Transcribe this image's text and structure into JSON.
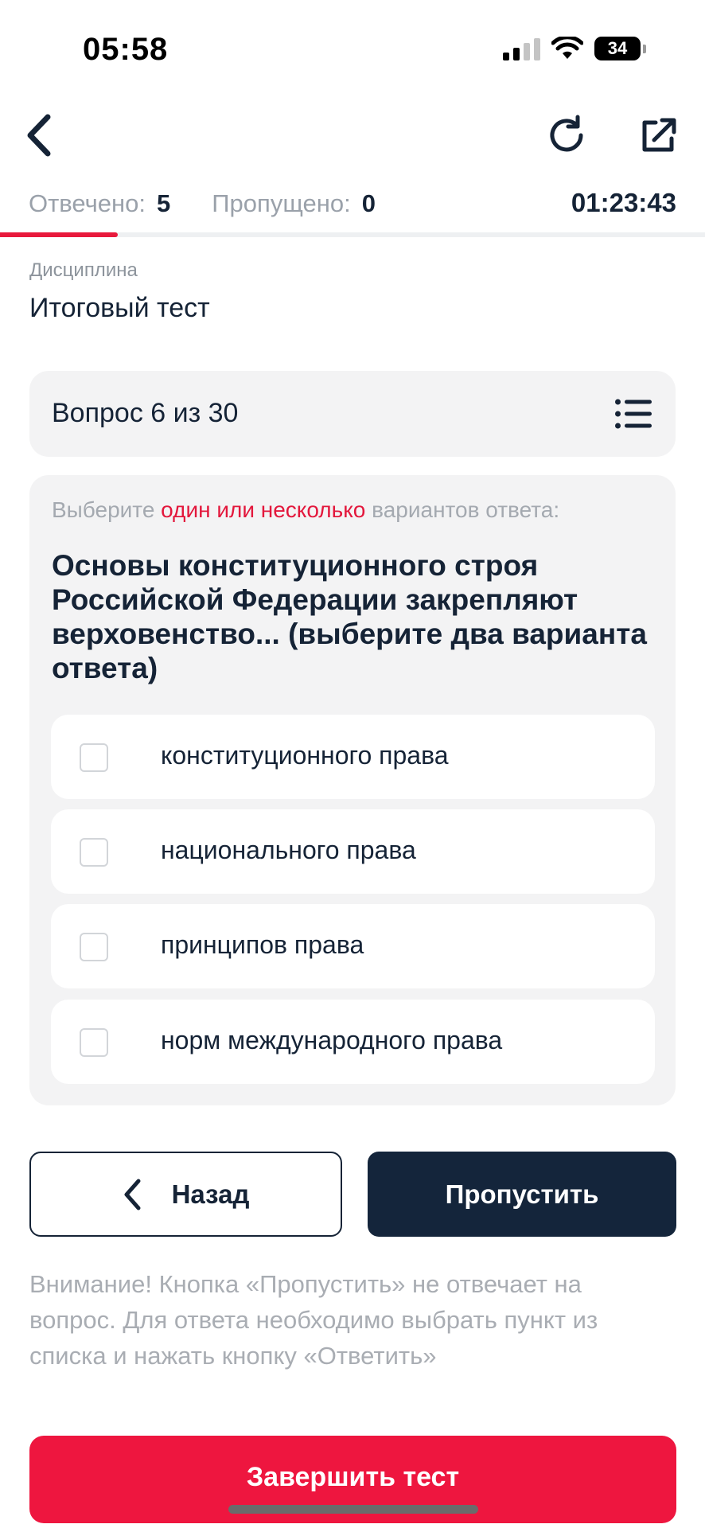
{
  "status_bar": {
    "time": "05:58",
    "battery": "34"
  },
  "nav": {
    "back_icon": "chevron-left-icon",
    "reload_icon": "refresh-icon",
    "share_icon": "external-link-icon"
  },
  "progress": {
    "answered_label": "Отвечено:",
    "answered_value": "5",
    "skipped_label": "Пропущено:",
    "skipped_value": "0",
    "timer": "01:23:43",
    "fraction": 0.1667
  },
  "discipline": {
    "label": "Дисциплина",
    "value": "Итоговый тест"
  },
  "question_header": {
    "label": "Вопрос 6 из 30",
    "list_icon": "list-icon"
  },
  "question": {
    "instruction_prefix": "Выберите",
    "instruction_accent": "один или несколько",
    "instruction_suffix": "вариантов ответа:",
    "text": "Основы конституционного строя Российской Федерации закрепляют верховенство... (выберите два варианта ответа)",
    "options": [
      {
        "label": "конституционного права",
        "checked": false
      },
      {
        "label": "национального права",
        "checked": false
      },
      {
        "label": "принципов права",
        "checked": false
      },
      {
        "label": "норм международного права",
        "checked": false
      }
    ]
  },
  "buttons": {
    "back": "Назад",
    "skip": "Пропустить",
    "finish": "Завершить тест"
  },
  "notice": "Внимание! Кнопка «Пропустить» не отвечает на вопрос. Для ответа необходимо выбрать пункт из списка и нажать кнопку «Ответить»",
  "colors": {
    "accent": "#e8193c",
    "primary_dark": "#14253b",
    "text": "#152336",
    "muted": "#9aa1aa"
  }
}
